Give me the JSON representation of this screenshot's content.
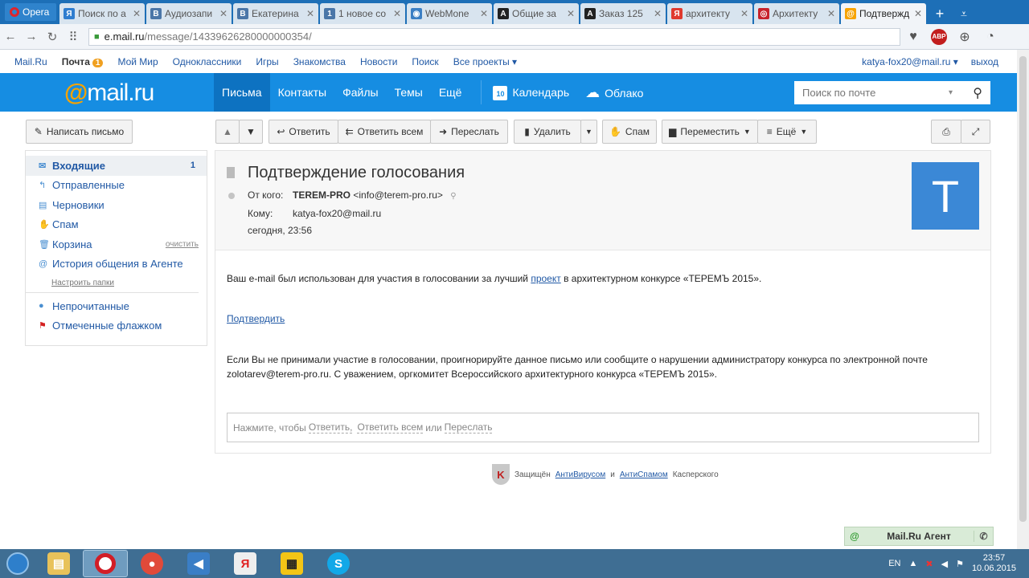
{
  "browser": {
    "app_name": "Opera",
    "tabs": [
      {
        "label": "Поиск по а",
        "fav": "ya-icon",
        "fav_color": "#2f7dcf",
        "glyph": "Я"
      },
      {
        "label": "Аудиозапи",
        "fav": "vk-icon",
        "fav_color": "#4a76a8",
        "glyph": "B"
      },
      {
        "label": "Екатерина",
        "fav": "vk-icon",
        "fav_color": "#4a76a8",
        "glyph": "B"
      },
      {
        "label": "1 новое со",
        "fav": "vk-icon",
        "fav_color": "#4a76a8",
        "glyph": "1"
      },
      {
        "label": "WebMone",
        "fav": "globe-icon",
        "fav_color": "#3b7fc4",
        "glyph": "◉"
      },
      {
        "label": "Общие за",
        "fav": "a-icon",
        "fav_color": "#222222",
        "glyph": "A"
      },
      {
        "label": "Заказ 125",
        "fav": "a-icon",
        "fav_color": "#222222",
        "glyph": "A"
      },
      {
        "label": "архитекту",
        "fav": "yandex-icon",
        "fav_color": "#e03a2f",
        "glyph": "Я"
      },
      {
        "label": "Архитекту",
        "fav": "circle-icon",
        "fav_color": "#c8232b",
        "glyph": "◎"
      },
      {
        "label": "Подтвержд",
        "fav": "mailru-icon",
        "fav_color": "#f7a300",
        "glyph": "@",
        "active": true
      }
    ],
    "url_host": "e.mail.ru",
    "url_path": "/message/14339626280000000354/"
  },
  "portal": {
    "links": [
      "Mail.Ru",
      "Почта",
      "Мой Мир",
      "Одноклассники",
      "Игры",
      "Знакомства",
      "Новости",
      "Поиск",
      "Все проекты ▾"
    ],
    "mail_badge": "1",
    "user": "katya-fox20@mail.ru ▾",
    "logout": "выход"
  },
  "header": {
    "logo_at": "@",
    "logo_text": "mail.ru",
    "nav": [
      "Письма",
      "Контакты",
      "Файлы",
      "Темы",
      "Ещё"
    ],
    "calendar": "Календарь",
    "calendar_day": "10",
    "cloud": "Облако",
    "search_placeholder": "Поиск по почте"
  },
  "toolbar": {
    "compose": "Написать письмо",
    "reply": "Ответить",
    "reply_all": "Ответить всем",
    "forward": "Переслать",
    "delete": "Удалить",
    "spam": "Спам",
    "move": "Переместить",
    "more": "Ещё"
  },
  "sidebar": {
    "folders": [
      {
        "label": "Входящие",
        "icon": "envelope-icon",
        "glyph": "✉",
        "count": "1",
        "active": true
      },
      {
        "label": "Отправленные",
        "icon": "sent-icon",
        "glyph": "↰"
      },
      {
        "label": "Черновики",
        "icon": "draft-icon",
        "glyph": "▤"
      },
      {
        "label": "Спам",
        "icon": "thumb-down-icon",
        "glyph": "✋"
      },
      {
        "label": "Корзина",
        "icon": "trash-icon",
        "glyph": "🗑",
        "extra": "очистить"
      },
      {
        "label": "История общения в Агенте",
        "icon": "agent-icon",
        "glyph": "@"
      }
    ],
    "setup": "Настроить папки",
    "filters": [
      {
        "label": "Непрочитанные",
        "icon": "unread-dot-icon",
        "glyph": "●"
      },
      {
        "label": "Отмеченные флажком",
        "icon": "flag-icon",
        "glyph": "⚑"
      }
    ]
  },
  "message": {
    "subject": "Подтверждение голосования",
    "from_label": "От кого:",
    "from_name": "TEREM-PRO",
    "from_email": "<info@terem-pro.ru>",
    "to_label": "Кому:",
    "to": "katya-fox20@mail.ru",
    "date": "сегодня, 23:56",
    "avatar_letter": "T",
    "p1_before": "Ваш e-mail был использован для участия в голосовании за лучший",
    "p1_link": "проект",
    "p1_after": "в архитектурном конкурсе «ТЕРЕМЪ 2015».",
    "confirm_link": "Подтвердить",
    "p3": "Если Вы не принимали участие в голосовании, проигнорируйте данное письмо или сообщите о нарушении администратору конкурса по электронной почте zolotarev@terem-pro.ru. С уважением, оргкомитет Всероссийского архитектурного конкурса «ТЕРЕМЪ 2015».",
    "reply_prompt": "Нажмите, чтобы",
    "reply_opt1": "Ответить,",
    "reply_opt2": "Ответить всем",
    "reply_or": "или",
    "reply_opt3": "Переслать"
  },
  "kaspersky": {
    "before": "Защищён",
    "link1": "АнтиВирусом",
    "and": "и",
    "link2": "АнтиСпамом",
    "after": "Касперского"
  },
  "agent": {
    "label": "Mail.Ru Агент"
  },
  "taskbar": {
    "lang": "EN",
    "time": "23:57",
    "date": "10.06.2015"
  }
}
